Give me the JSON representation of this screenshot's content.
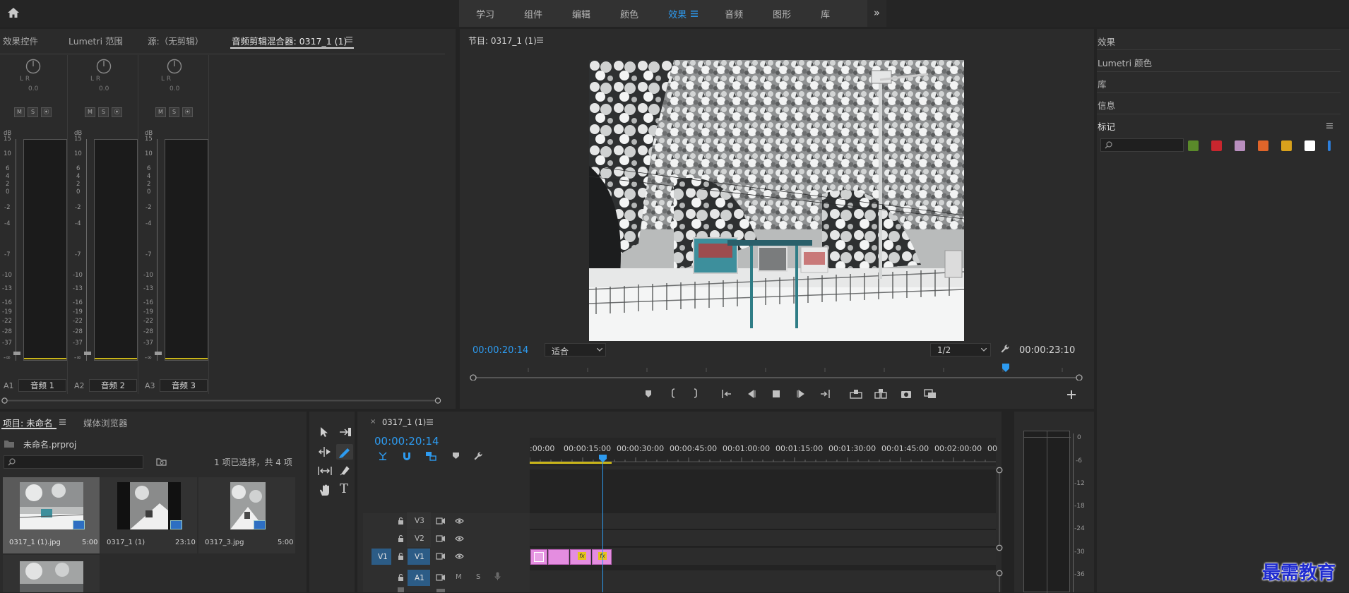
{
  "workspace_tabs": [
    "学习",
    "组件",
    "编辑",
    "颜色",
    "效果",
    "音频",
    "图形",
    "库"
  ],
  "workspace_active": "效果",
  "left_panel": {
    "tabs": [
      "效果控件",
      "Lumetri 范围",
      "源:（无剪辑）",
      "音频剪辑混合器: 0317_1 (1)"
    ],
    "active_tab": "音频剪辑混合器: 0317_1 (1)"
  },
  "mixer": {
    "pan_lr": "L  R",
    "pan_value": "0.0",
    "buttons": [
      "M",
      "S",
      "⦿"
    ],
    "db_label": "dB",
    "db_scale": [
      "15",
      "10",
      "6",
      "4",
      "2",
      "0",
      "-2",
      "-4",
      "-7",
      "-10",
      "-13",
      "-16",
      "-19",
      "-22",
      "-28",
      "-37",
      "-∞"
    ],
    "channels": [
      {
        "id": "A1",
        "name": "音频 1"
      },
      {
        "id": "A2",
        "name": "音频 2"
      },
      {
        "id": "A3",
        "name": "音频 3"
      }
    ]
  },
  "program_monitor": {
    "title": "节目: 0317_1 (1)",
    "current_tc": "00:00:20:14",
    "fit": "适合",
    "resolution": "1/2",
    "duration_tc": "00:00:23:10"
  },
  "right_panel": {
    "items": [
      "效果",
      "Lumetri 颜色",
      "库",
      "信息",
      "标记"
    ],
    "swatch_colors": [
      "#5a8a2a",
      "#c8262e",
      "#b98fbf",
      "#e0652a",
      "#d9a21c",
      "#ffffff",
      "#2d7fdc"
    ]
  },
  "project_panel": {
    "tabs": [
      "项目: 未命名",
      "媒体浏览器"
    ],
    "project_file": "未命名.prproj",
    "selection_info": "1 项已选择，共 4 项",
    "items": [
      {
        "name": "0317_1 (1).jpg",
        "duration": "5:00"
      },
      {
        "name": "0317_1 (1)",
        "duration": "23:10"
      },
      {
        "name": "0317_3.jpg",
        "duration": "5:00"
      }
    ]
  },
  "timeline": {
    "sequence": "0317_1 (1)",
    "current_tc": "00:00:20:14",
    "ruler": [
      ":00:00",
      "00:00:15:00",
      "00:00:30:00",
      "00:00:45:00",
      "00:01:00:00",
      "00:01:15:00",
      "00:01:30:00",
      "00:01:45:00",
      "00:02:00:00",
      "00"
    ],
    "tracks": [
      {
        "src": "",
        "id": "V3"
      },
      {
        "src": "",
        "id": "V2"
      },
      {
        "src": "V1",
        "id": "V1"
      },
      {
        "src": "",
        "id": "A1"
      }
    ],
    "audio_track_buttons": [
      "M",
      "S"
    ],
    "clip_badge": "fx"
  },
  "audio_meter": {
    "scale": [
      "0",
      "-6",
      "-12",
      "-18",
      "-24",
      "-30",
      "-36"
    ]
  },
  "watermark": "最需教育"
}
